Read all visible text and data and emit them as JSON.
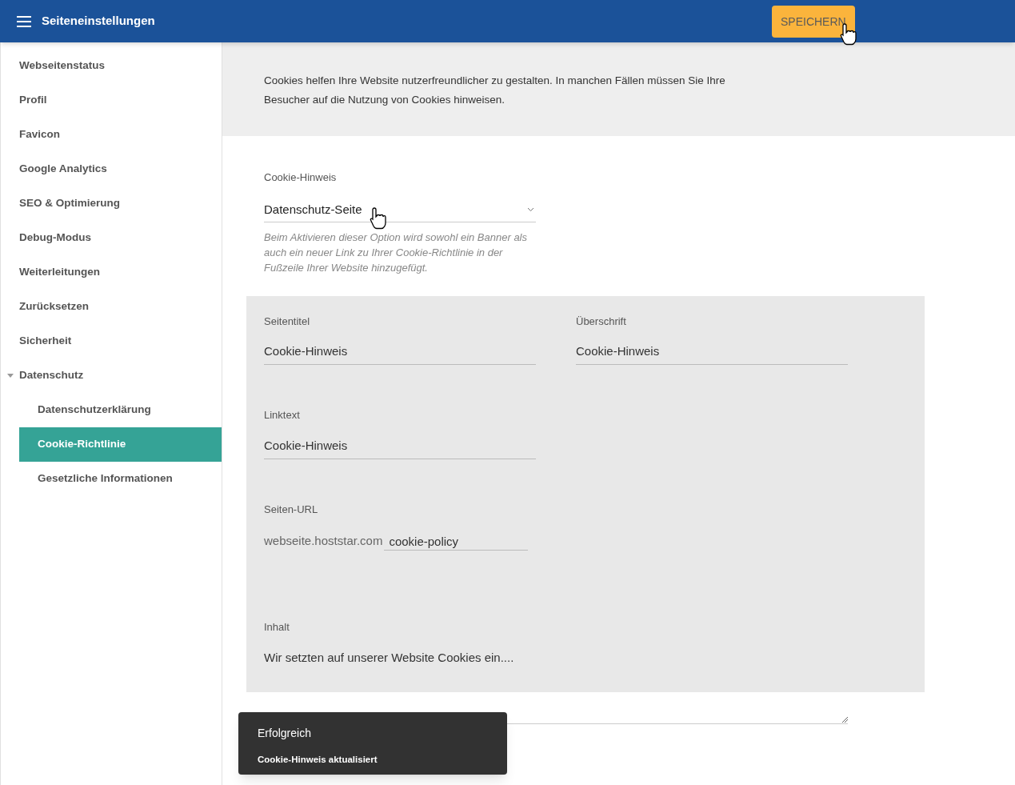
{
  "header": {
    "title": "Seiteneinstellungen",
    "save_button": "SPEICHERN"
  },
  "sidebar": {
    "items": [
      {
        "label": "Webseitenstatus",
        "selected": false
      },
      {
        "label": "Profil",
        "selected": false
      },
      {
        "label": "Favicon",
        "selected": false
      },
      {
        "label": "Google Analytics",
        "selected": false
      },
      {
        "label": "SEO & Optimierung",
        "selected": false
      },
      {
        "label": "Debug-Modus",
        "selected": false
      },
      {
        "label": "Weiterleitungen",
        "selected": false
      },
      {
        "label": "Zurücksetzen",
        "selected": false
      },
      {
        "label": "Sicherheit",
        "selected": false
      },
      {
        "label": "Datenschutz",
        "selected": false,
        "expanded": true,
        "children": [
          {
            "label": "Datenschutzerklärung",
            "selected": false
          },
          {
            "label": "Cookie-Richtlinie",
            "selected": true
          },
          {
            "label": "Gesetzliche Informationen",
            "selected": false
          }
        ]
      }
    ]
  },
  "intro": "Cookies helfen Ihre Website nutzerfreundlicher zu gestalten. In manchen Fällen müssen Sie Ihre Besucher auf die Nutzung von Cookies hinweisen.",
  "cookie_notice": {
    "label": "Cookie-Hinweis",
    "value": "Datenschutz-Seite",
    "help": "Beim Aktivieren dieser Option wird sowohl ein Banner als auch ein neuer Link zu Ihrer Cookie-Richtlinie in der Fußzeile Ihrer Website hinzugefügt."
  },
  "page_title": {
    "label": "Seitentitel",
    "value": "Cookie-Hinweis"
  },
  "heading": {
    "label": "Überschrift",
    "value": "Cookie-Hinweis"
  },
  "link_text": {
    "label": "Linktext",
    "value": "Cookie-Hinweis"
  },
  "page_url": {
    "label": "Seiten-URL",
    "prefix": "webseite.hoststar.com",
    "value": "cookie-policy"
  },
  "content": {
    "label": "Inhalt",
    "value": "Wir setzten auf unserer Website Cookies ein...."
  },
  "toast": {
    "title": "Erfolgreich",
    "message": "Cookie-Hinweis aktualisiert"
  }
}
